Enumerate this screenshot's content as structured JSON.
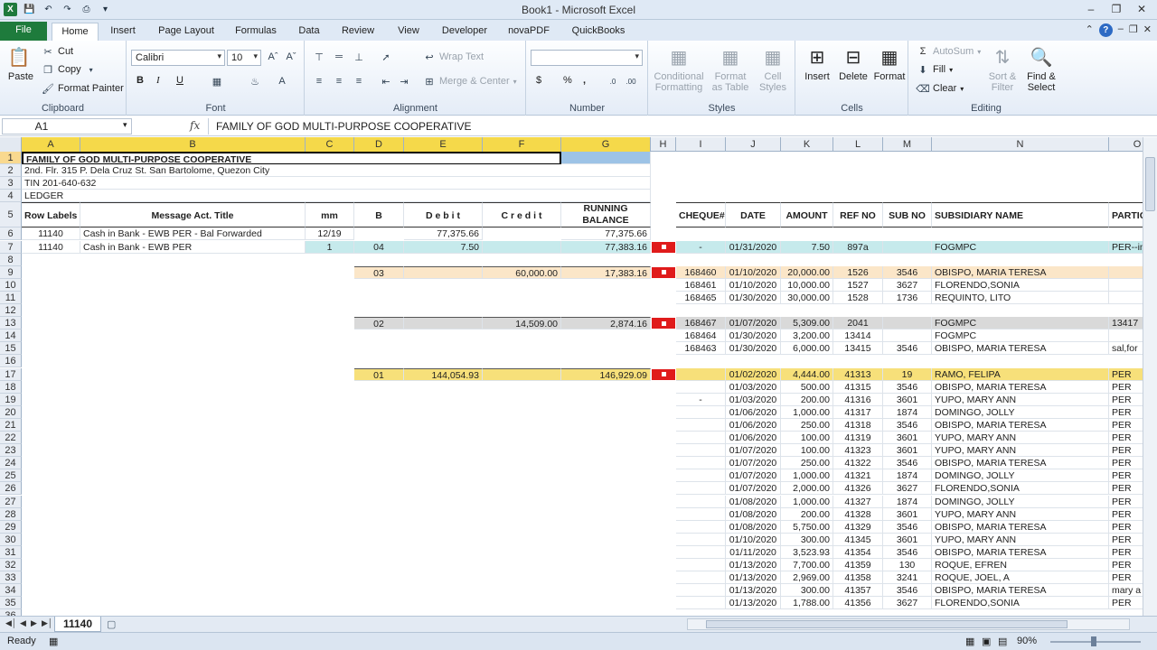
{
  "app": {
    "title": "Book1  -  Microsoft Excel"
  },
  "ribbon_tabs": [
    "File",
    "Home",
    "Insert",
    "Page Layout",
    "Formulas",
    "Data",
    "Review",
    "View",
    "Developer",
    "novaPDF",
    "QuickBooks"
  ],
  "ribbon": {
    "clipboard": {
      "label": "Clipboard",
      "paste": "Paste",
      "cut": "Cut",
      "copy": "Copy",
      "format_painter": "Format Painter"
    },
    "font": {
      "label": "Font",
      "font_name": "Calibri",
      "font_size": "10",
      "bold": "B",
      "italic": "I",
      "underline": "U"
    },
    "alignment": {
      "label": "Alignment",
      "wrap_text": "Wrap Text",
      "merge_center": "Merge & Center"
    },
    "number": {
      "label": "Number",
      "format_value": "",
      "currency": "$",
      "percent": "%",
      "comma": ","
    },
    "styles": {
      "label": "Styles",
      "conditional": "Conditional Formatting",
      "format_table": "Format as Table",
      "cell_styles": "Cell Styles"
    },
    "cells": {
      "label": "Cells",
      "insert": "Insert",
      "delete": "Delete",
      "format": "Format"
    },
    "editing": {
      "label": "Editing",
      "autosum": "AutoSum",
      "fill": "Fill",
      "clear": "Clear",
      "sort_filter": "Sort & Filter",
      "find_select": "Find & Select"
    }
  },
  "formula_bar": {
    "name_box": "A1",
    "fx": "fx",
    "content": "FAMILY OF GOD MULTI-PURPOSE COOPERATIVE"
  },
  "columns": [
    "A",
    "B",
    "C",
    "D",
    "E",
    "F",
    "G",
    "H",
    "I",
    "J",
    "K",
    "L",
    "M",
    "N",
    "O"
  ],
  "sheet": {
    "r1": "FAMILY OF GOD MULTI-PURPOSE COOPERATIVE",
    "r2": "2nd. Flr. 315 P. Dela Cruz St. San Bartolome, Quezon City",
    "r3": "TIN 201-640-632",
    "r4": "LEDGER",
    "headers": {
      "row_labels": "Row Labels",
      "message": "Message Act. Title",
      "mm": "mm",
      "b": "B",
      "debit": "D e b i t",
      "credit": "C r e d i t",
      "running1": "RUNNING",
      "running2": "BALANCE",
      "cheque": "CHEQUE#",
      "date": "DATE",
      "amount": "AMOUNT",
      "refno": "REF NO",
      "subno": "SUB NO",
      "subsidiary": "SUBSIDIARY NAME",
      "partic": "PARTIC"
    },
    "r6": {
      "a": "11140",
      "b": "Cash in Bank - EWB PER - Bal Forwarded",
      "c": "12/19",
      "e": "77,375.66",
      "g": "77,375.66"
    },
    "r7": {
      "a": "11140",
      "b": "Cash in Bank - EWB PER",
      "c": "1",
      "d": "04",
      "e": "7.50",
      "g": "77,383.16"
    },
    "r9": {
      "d": "03",
      "f": "60,000.00",
      "g": "17,383.16"
    },
    "r13": {
      "d": "02",
      "f": "14,509.00",
      "g": "2,874.16"
    },
    "r17": {
      "d": "01",
      "e": "144,054.93",
      "g": "146,929.09"
    },
    "right": [
      {
        "row": 7,
        "i": "-",
        "j": "01/31/2020",
        "k": "7.50",
        "l": "897a",
        "m": "",
        "n": "FOGMPC",
        "o": "PER--in"
      },
      {
        "row": 9,
        "i": "168460",
        "j": "01/10/2020",
        "k": "20,000.00",
        "l": "1526",
        "m": "3546",
        "n": "OBISPO, MARIA  TERESA",
        "o": ""
      },
      {
        "row": 10,
        "i": "168461",
        "j": "01/10/2020",
        "k": "10,000.00",
        "l": "1527",
        "m": "3627",
        "n": "FLORENDO,SONIA",
        "o": ""
      },
      {
        "row": 11,
        "i": "168465",
        "j": "01/30/2020",
        "k": "30,000.00",
        "l": "1528",
        "m": "1736",
        "n": "REQUINTO, LITO",
        "o": ""
      },
      {
        "row": 13,
        "i": "168467",
        "j": "01/07/2020",
        "k": "5,309.00",
        "l": "2041",
        "m": "",
        "n": "FOGMPC",
        "o": "13417"
      },
      {
        "row": 14,
        "i": "168464",
        "j": "01/30/2020",
        "k": "3,200.00",
        "l": "13414",
        "m": "",
        "n": "FOGMPC",
        "o": ""
      },
      {
        "row": 15,
        "i": "168463",
        "j": "01/30/2020",
        "k": "6,000.00",
        "l": "13415",
        "m": "3546",
        "n": "OBISPO, MARIA  TERESA",
        "o": "sal,for"
      },
      {
        "row": 17,
        "i": "",
        "j": "01/02/2020",
        "k": "4,444.00",
        "l": "41313",
        "m": "19",
        "n": "RAMO, FELIPA",
        "o": "PER"
      },
      {
        "row": 18,
        "i": "",
        "j": "01/03/2020",
        "k": "500.00",
        "l": "41315",
        "m": "3546",
        "n": "OBISPO, MARIA  TERESA",
        "o": "PER"
      },
      {
        "row": 19,
        "i": "-",
        "j": "01/03/2020",
        "k": "200.00",
        "l": "41316",
        "m": "3601",
        "n": "YUPO, MARY ANN",
        "o": "PER"
      },
      {
        "row": 20,
        "i": "",
        "j": "01/06/2020",
        "k": "1,000.00",
        "l": "41317",
        "m": "1874",
        "n": "DOMINGO, JOLLY",
        "o": "PER"
      },
      {
        "row": 21,
        "i": "",
        "j": "01/06/2020",
        "k": "250.00",
        "l": "41318",
        "m": "3546",
        "n": "OBISPO, MARIA  TERESA",
        "o": "PER"
      },
      {
        "row": 22,
        "i": "",
        "j": "01/06/2020",
        "k": "100.00",
        "l": "41319",
        "m": "3601",
        "n": "YUPO, MARY ANN",
        "o": "PER"
      },
      {
        "row": 23,
        "i": "",
        "j": "01/07/2020",
        "k": "100.00",
        "l": "41323",
        "m": "3601",
        "n": "YUPO, MARY ANN",
        "o": "PER"
      },
      {
        "row": 24,
        "i": "",
        "j": "01/07/2020",
        "k": "250.00",
        "l": "41322",
        "m": "3546",
        "n": "OBISPO, MARIA  TERESA",
        "o": "PER"
      },
      {
        "row": 25,
        "i": "",
        "j": "01/07/2020",
        "k": "1,000.00",
        "l": "41321",
        "m": "1874",
        "n": "DOMINGO, JOLLY",
        "o": "PER"
      },
      {
        "row": 26,
        "i": "",
        "j": "01/07/2020",
        "k": "2,000.00",
        "l": "41326",
        "m": "3627",
        "n": "FLORENDO,SONIA",
        "o": "PER"
      },
      {
        "row": 27,
        "i": "",
        "j": "01/08/2020",
        "k": "1,000.00",
        "l": "41327",
        "m": "1874",
        "n": "DOMINGO, JOLLY",
        "o": "PER"
      },
      {
        "row": 28,
        "i": "",
        "j": "01/08/2020",
        "k": "200.00",
        "l": "41328",
        "m": "3601",
        "n": "YUPO, MARY ANN",
        "o": "PER"
      },
      {
        "row": 29,
        "i": "",
        "j": "01/08/2020",
        "k": "5,750.00",
        "l": "41329",
        "m": "3546",
        "n": "OBISPO, MARIA  TERESA",
        "o": "PER"
      },
      {
        "row": 30,
        "i": "",
        "j": "01/10/2020",
        "k": "300.00",
        "l": "41345",
        "m": "3601",
        "n": "YUPO, MARY ANN",
        "o": "PER"
      },
      {
        "row": 31,
        "i": "",
        "j": "01/11/2020",
        "k": "3,523.93",
        "l": "41354",
        "m": "3546",
        "n": "OBISPO, MARIA  TERESA",
        "o": "PER"
      },
      {
        "row": 32,
        "i": "",
        "j": "01/13/2020",
        "k": "7,700.00",
        "l": "41359",
        "m": "130",
        "n": "ROQUE, EFREN",
        "o": "PER"
      },
      {
        "row": 33,
        "i": "",
        "j": "01/13/2020",
        "k": "2,969.00",
        "l": "41358",
        "m": "3241",
        "n": "ROQUE, JOEL, A",
        "o": "PER"
      },
      {
        "row": 34,
        "i": "",
        "j": "01/13/2020",
        "k": "300.00",
        "l": "41357",
        "m": "3546",
        "n": "OBISPO, MARIA  TERESA",
        "o": "mary a"
      },
      {
        "row": 35,
        "i": "",
        "j": "01/13/2020",
        "k": "1,788.00",
        "l": "41356",
        "m": "3627",
        "n": "FLORENDO,SONIA",
        "o": "PER"
      }
    ]
  },
  "sheet_tab": "11140",
  "status": {
    "ready": "Ready",
    "zoom": "90%"
  },
  "colors": {
    "file_tab": "#1e7b3c",
    "yellow_header": "#f5d94a",
    "cyan_row": "#c6eaec",
    "peach_row": "#fbe6c8",
    "gray_row": "#d9d9d9",
    "yellow_row": "#f7e07a",
    "red_marker": "#e01b1b",
    "blue_cell": "#9dc3e6"
  }
}
